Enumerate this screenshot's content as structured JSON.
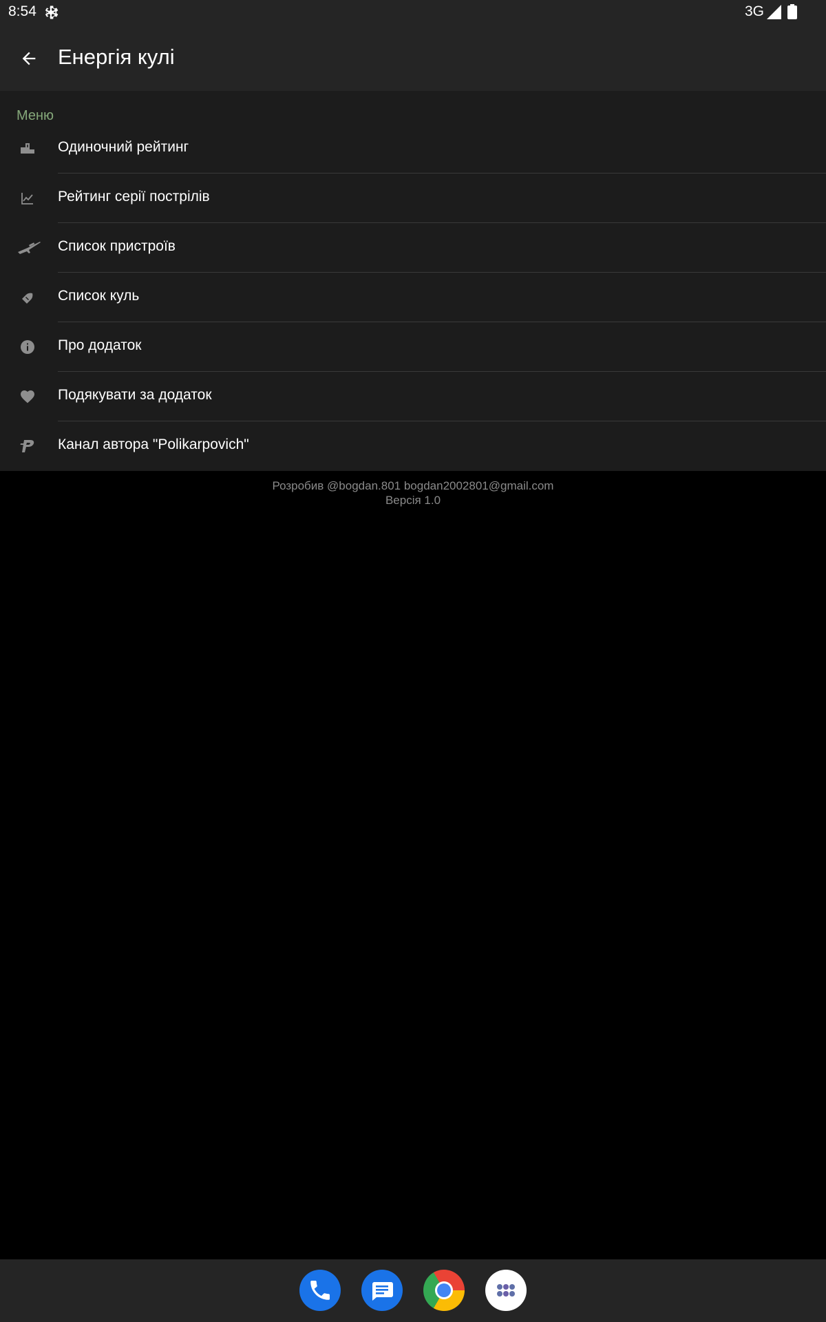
{
  "status_bar": {
    "time": "8:54",
    "network": "3G",
    "icons": [
      "gear-icon",
      "cell-signal-icon",
      "battery-icon"
    ]
  },
  "app_bar": {
    "back_icon": "arrow-back-icon",
    "title": "Енергія кулі"
  },
  "menu": {
    "header": "Меню",
    "items": [
      {
        "icon": "podium-icon",
        "label": "Одиночний рейтинг"
      },
      {
        "icon": "line-chart-icon",
        "label": "Рейтинг серії пострілів"
      },
      {
        "icon": "rifle-icon",
        "label": "Список пристроїв"
      },
      {
        "icon": "bullets-icon",
        "label": "Список куль"
      },
      {
        "icon": "info-icon",
        "label": "Про додаток"
      },
      {
        "icon": "heart-icon",
        "label": "Подякувати за додаток"
      },
      {
        "icon": "p-logo-icon",
        "label": "Канал автора \"Polikarpovich\""
      }
    ]
  },
  "footer": {
    "developer": "Розробив @bogdan.801 bogdan2002801@gmail.com",
    "version": "Версія 1.0"
  },
  "dock": {
    "apps": [
      "phone-app-icon",
      "messages-app-icon",
      "chrome-app-icon",
      "app-drawer-icon"
    ]
  },
  "colors": {
    "background": "#000000",
    "bar_background": "#252525",
    "menu_background": "#1c1c1c",
    "menu_header": "#85a87a",
    "icon_gray": "#8e8e8e",
    "footer_text": "#8a8a8a"
  }
}
